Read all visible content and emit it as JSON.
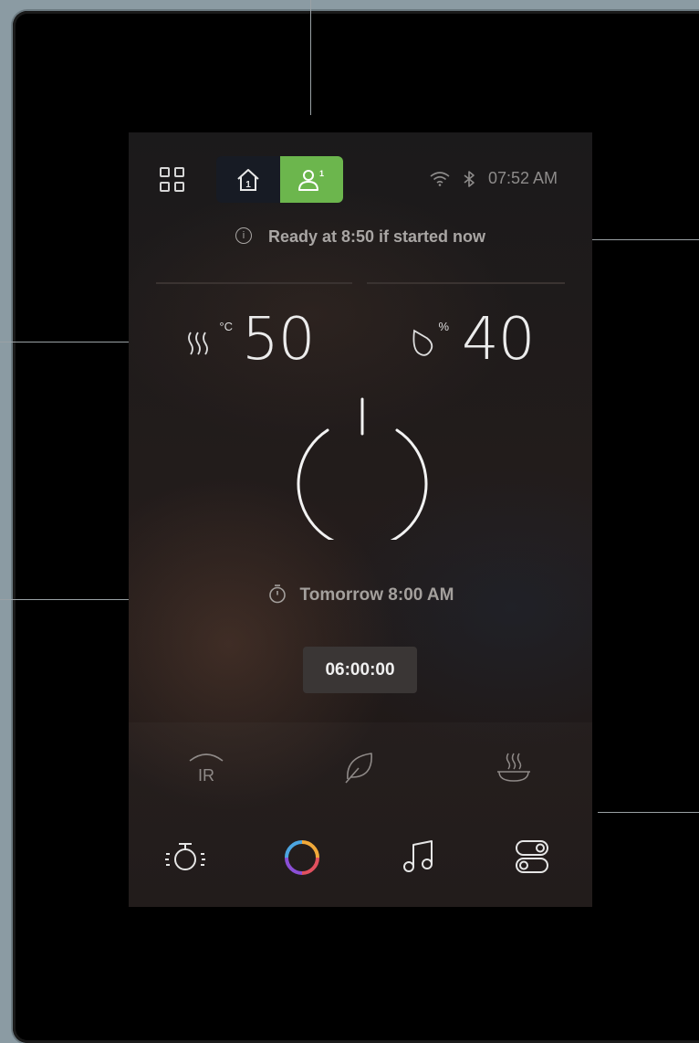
{
  "status": {
    "time": "07:52 AM",
    "ready_message": "Ready at 8:50 if started now"
  },
  "mode_toggle": {
    "items": [
      {
        "name": "home-1",
        "icon": "home-1-icon",
        "active": false
      },
      {
        "name": "user-1",
        "icon": "user-1-icon",
        "active": true
      }
    ],
    "active_color": "#6cb64d"
  },
  "temperature": {
    "value": "50",
    "unit": "°C",
    "icon": "heat-waves-icon"
  },
  "humidity": {
    "value": "40",
    "unit": "%",
    "icon": "water-drop-icon"
  },
  "schedule": {
    "label": "Tomorrow 8:00 AM",
    "icon": "stopwatch-icon"
  },
  "timer": {
    "value": "06:00:00"
  },
  "modes": [
    {
      "name": "infrared",
      "label": "IR",
      "icon": "infrared-icon"
    },
    {
      "name": "eco",
      "icon": "leaf-icon"
    },
    {
      "name": "steam",
      "icon": "steam-icon"
    }
  ],
  "bottom_nav": [
    {
      "name": "light",
      "icon": "light-bulb-icon"
    },
    {
      "name": "color",
      "icon": "color-ring-icon"
    },
    {
      "name": "music",
      "icon": "music-note-icon"
    },
    {
      "name": "switches",
      "icon": "toggle-switches-icon"
    }
  ]
}
